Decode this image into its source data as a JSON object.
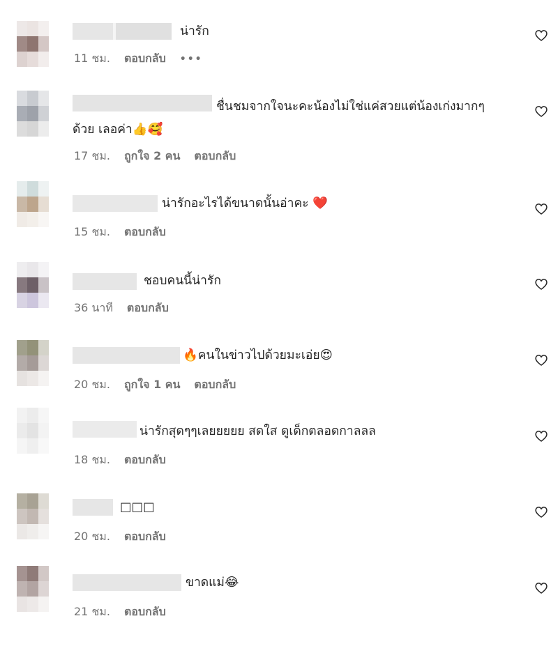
{
  "comments": [
    {
      "text": "น่ารัก",
      "time": "11 ชม.",
      "likes": "",
      "reply_label": "ตอบกลับ",
      "more": "•••"
    },
    {
      "text": "ชื่นชมจากใจนะคะน้องไม่ใช่แค่สวยแต่น้องเก่งมากๆด้วย เลอค่า👍🥰",
      "time": "17 ชม.",
      "likes": "ถูกใจ 2 คน",
      "reply_label": "ตอบกลับ",
      "more": ""
    },
    {
      "text": "น่ารักอะไรได้ขนาดนั้นอ่าคะ ❤️",
      "time": "15 ชม.",
      "likes": "",
      "reply_label": "ตอบกลับ",
      "more": ""
    },
    {
      "text": "ชอบคนนี้น่ารัก",
      "time": "36 นาที",
      "likes": "",
      "reply_label": "ตอบกลับ",
      "more": ""
    },
    {
      "text": "🔥คนในข่าวไปด้วยมะเอ่ย😍",
      "time": "20 ชม.",
      "likes": "ถูกใจ 1 คน",
      "reply_label": "ตอบกลับ",
      "more": ""
    },
    {
      "text": "น่ารักสุดๆๆเลยยยยย สดใส ดูเด็กตลอดกาลลล",
      "time": "18 ชม.",
      "likes": "",
      "reply_label": "ตอบกลับ",
      "more": ""
    },
    {
      "text": "□□□",
      "time": "20 ชม.",
      "likes": "",
      "reply_label": "ตอบกลับ",
      "more": ""
    },
    {
      "text": "ขาดแม่😂",
      "time": "21 ชม.",
      "likes": "",
      "reply_label": "ตอบกลับ",
      "more": ""
    }
  ],
  "icons": {
    "like": "heart-outline-icon",
    "more": "more-options-icon"
  },
  "colors": {
    "text": "#262626",
    "secondary": "#737373",
    "background": "#ffffff"
  }
}
